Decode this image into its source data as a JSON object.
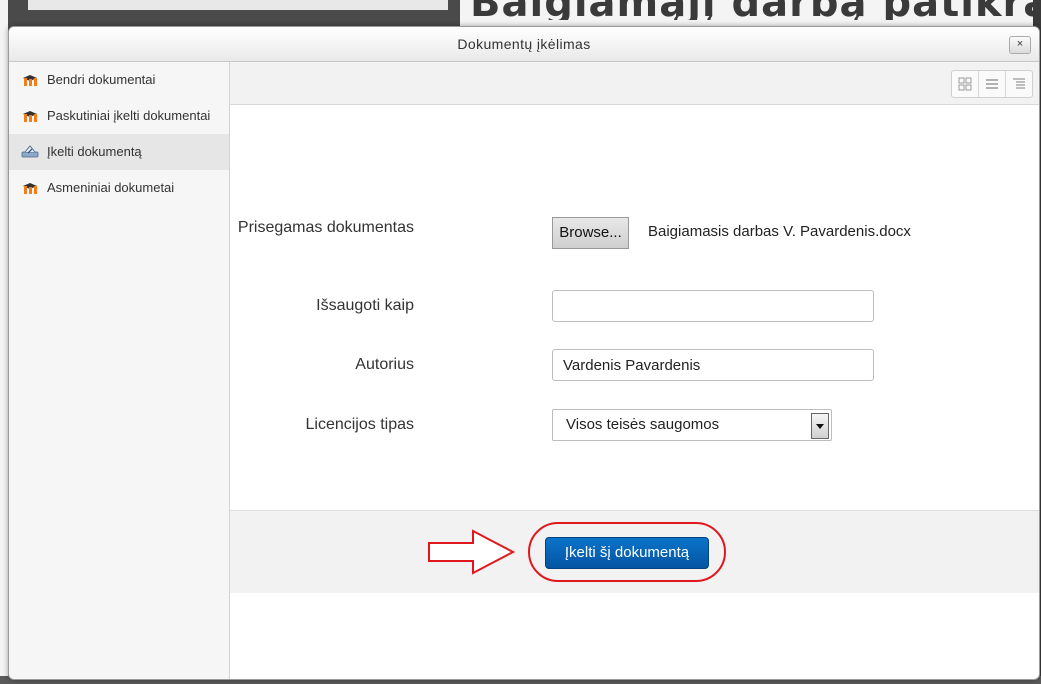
{
  "background": {
    "page_title": "Baigiamąjį darbą patikra"
  },
  "modal": {
    "title": "Dokumentų įkėlimas",
    "close_label": "×"
  },
  "sidebar": {
    "items": [
      {
        "label": "Bendri dokumentai",
        "icon": "moodle-icon",
        "active": false
      },
      {
        "label": "Paskutiniai įkelti dokumentai",
        "icon": "moodle-icon",
        "active": false
      },
      {
        "label": "Įkelti dokumentą",
        "icon": "upload-icon",
        "active": true
      },
      {
        "label": "Asmeniniai dokumetai",
        "icon": "moodle-icon",
        "active": false
      }
    ]
  },
  "toolbar": {
    "views": [
      "icons-view-icon",
      "list-view-icon",
      "tree-view-icon"
    ]
  },
  "form": {
    "attachment_label": "Prisegamas dokumentas",
    "browse_label": "Browse...",
    "file_name": "Baigiamasis darbas V. Pavardenis.docx",
    "save_as_label": "Išsaugoti kaip",
    "save_as_value": "",
    "author_label": "Autorius",
    "author_value": "Vardenis Pavardenis",
    "license_label": "Licencijos tipas",
    "license_value": "Visos teisės saugomos"
  },
  "footer": {
    "upload_button_label": "Įkelti šį dokumentą"
  },
  "colors": {
    "upload_button": "#0a64b5",
    "highlight": "#e0181e",
    "moodle_icon": "#f07e1b"
  }
}
